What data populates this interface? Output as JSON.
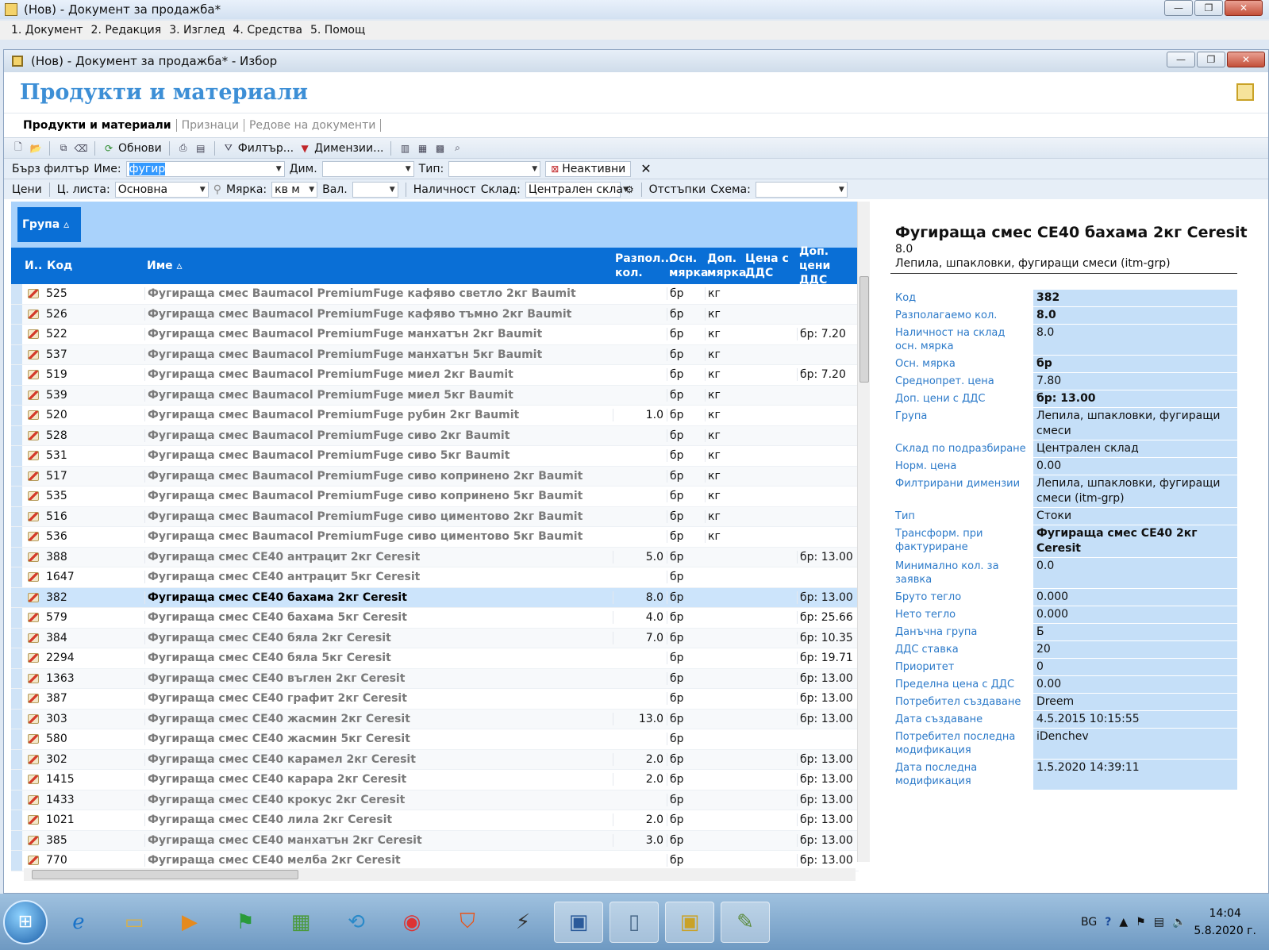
{
  "outer": {
    "title": "(Нов) - Документ за продажба*",
    "menu": [
      "1. Документ",
      "2. Редакция",
      "3. Изглед",
      "4. Средства",
      "5. Помощ"
    ]
  },
  "inner": {
    "title": "(Нов) - Документ за продажба* - Избор",
    "page_title": "Продукти и материали",
    "tabs": [
      "Продукти и материали",
      "Признаци",
      "Редове на документи"
    ]
  },
  "toolbar": {
    "refresh": "Обнови",
    "filter": "Филтър...",
    "dimensions": "Димензии..."
  },
  "filter1": {
    "quick": "Бърз филтър",
    "name_label": "Име:",
    "name_value": "фугир",
    "dim_label": "Дим.",
    "type_label": "Тип:",
    "inactive": "Неактивни"
  },
  "filter2": {
    "prices": "Цени",
    "pricelist_label": "Ц. листа:",
    "pricelist_value": "Основна",
    "unit_label": "Мярка:",
    "unit_value": "кв м",
    "cur_label": "Вал.",
    "stock": "Наличност",
    "warehouse_label": "Склад:",
    "warehouse_value": "Централен скла",
    "discounts": "Отстъпки",
    "scheme_label": "Схема:"
  },
  "grid": {
    "group_chip": "Група ▵",
    "headers": {
      "icon": "И..",
      "code": "Код",
      "name": "Име ▵",
      "qty": "Разпол... кол.",
      "unit": "Осн. мярка",
      "unit2": "Доп. мярка",
      "price": "Цена с ДДС",
      "extra": "Доп. цени ДДС"
    },
    "rows": [
      {
        "code": "525",
        "name": "Фугираща смес Baumacol PremiumFuge кафяво светло 2кг Baumit",
        "qty": "",
        "unit": "бр",
        "unit2": "кг",
        "price": "",
        "extra": ""
      },
      {
        "code": "526",
        "name": "Фугираща смес Baumacol PremiumFuge кафяво тъмно 2кг Baumit",
        "qty": "",
        "unit": "бр",
        "unit2": "кг",
        "price": "",
        "extra": ""
      },
      {
        "code": "522",
        "name": "Фугираща смес Baumacol PremiumFuge манхатън 2кг Baumit",
        "qty": "",
        "unit": "бр",
        "unit2": "кг",
        "price": "",
        "extra": "бр: 7.20"
      },
      {
        "code": "537",
        "name": "Фугираща смес Baumacol PremiumFuge манхатън 5кг Baumit",
        "qty": "",
        "unit": "бр",
        "unit2": "кг",
        "price": "",
        "extra": ""
      },
      {
        "code": "519",
        "name": "Фугираща смес Baumacol PremiumFuge миел 2кг Baumit",
        "qty": "",
        "unit": "бр",
        "unit2": "кг",
        "price": "",
        "extra": "бр: 7.20"
      },
      {
        "code": "539",
        "name": "Фугираща смес Baumacol PremiumFuge миел 5кг Baumit",
        "qty": "",
        "unit": "бр",
        "unit2": "кг",
        "price": "",
        "extra": ""
      },
      {
        "code": "520",
        "name": "Фугираща смес Baumacol PremiumFuge рубин 2кг Baumit",
        "qty": "1.0",
        "unit": "бр",
        "unit2": "кг",
        "price": "",
        "extra": ""
      },
      {
        "code": "528",
        "name": "Фугираща смес Baumacol PremiumFuge сиво 2кг Baumit",
        "qty": "",
        "unit": "бр",
        "unit2": "кг",
        "price": "",
        "extra": ""
      },
      {
        "code": "531",
        "name": "Фугираща смес Baumacol PremiumFuge сиво 5кг Baumit",
        "qty": "",
        "unit": "бр",
        "unit2": "кг",
        "price": "",
        "extra": ""
      },
      {
        "code": "517",
        "name": "Фугираща смес Baumacol PremiumFuge сиво копринено 2кг Baumit",
        "qty": "",
        "unit": "бр",
        "unit2": "кг",
        "price": "",
        "extra": ""
      },
      {
        "code": "535",
        "name": "Фугираща смес Baumacol PremiumFuge сиво копринено 5кг Baumit",
        "qty": "",
        "unit": "бр",
        "unit2": "кг",
        "price": "",
        "extra": ""
      },
      {
        "code": "516",
        "name": "Фугираща смес Baumacol PremiumFuge сиво циментово 2кг Baumit",
        "qty": "",
        "unit": "бр",
        "unit2": "кг",
        "price": "",
        "extra": ""
      },
      {
        "code": "536",
        "name": "Фугираща смес Baumacol PremiumFuge сиво циментово 5кг Baumit",
        "qty": "",
        "unit": "бр",
        "unit2": "кг",
        "price": "",
        "extra": ""
      },
      {
        "code": "388",
        "name": "Фугираща смес CE40 антрацит 2кг Ceresit",
        "qty": "5.0",
        "unit": "бр",
        "unit2": "",
        "price": "",
        "extra": "бр: 13.00"
      },
      {
        "code": "1647",
        "name": "Фугираща смес CE40 антрацит 5кг Ceresit",
        "qty": "",
        "unit": "бр",
        "unit2": "",
        "price": "",
        "extra": ""
      },
      {
        "code": "382",
        "name": "Фугираща смес CE40 бахама 2кг Ceresit",
        "qty": "8.0",
        "unit": "бр",
        "unit2": "",
        "price": "",
        "extra": "бр: 13.00",
        "selected": true
      },
      {
        "code": "579",
        "name": "Фугираща смес CE40 бахама 5кг Ceresit",
        "qty": "4.0",
        "unit": "бр",
        "unit2": "",
        "price": "",
        "extra": "бр: 25.66"
      },
      {
        "code": "384",
        "name": "Фугираща смес CE40 бяла 2кг Ceresit",
        "qty": "7.0",
        "unit": "бр",
        "unit2": "",
        "price": "",
        "extra": "бр: 10.35"
      },
      {
        "code": "2294",
        "name": "Фугираща смес CE40 бяла 5кг Ceresit",
        "qty": "",
        "unit": "бр",
        "unit2": "",
        "price": "",
        "extra": "бр: 19.71"
      },
      {
        "code": "1363",
        "name": "Фугираща смес CE40 въглен 2кг Ceresit",
        "qty": "",
        "unit": "бр",
        "unit2": "",
        "price": "",
        "extra": "бр: 13.00"
      },
      {
        "code": "387",
        "name": "Фугираща смес CE40 графит 2кг Ceresit",
        "qty": "",
        "unit": "бр",
        "unit2": "",
        "price": "",
        "extra": "бр: 13.00"
      },
      {
        "code": "303",
        "name": "Фугираща смес CE40 жасмин 2кг Ceresit",
        "qty": "13.0",
        "unit": "бр",
        "unit2": "",
        "price": "",
        "extra": "бр: 13.00"
      },
      {
        "code": "580",
        "name": "Фугираща смес CE40 жасмин 5кг Ceresit",
        "qty": "",
        "unit": "бр",
        "unit2": "",
        "price": "",
        "extra": ""
      },
      {
        "code": "302",
        "name": "Фугираща смес CE40 карамел 2кг Ceresit",
        "qty": "2.0",
        "unit": "бр",
        "unit2": "",
        "price": "",
        "extra": "бр: 13.00"
      },
      {
        "code": "1415",
        "name": "Фугираща смес CE40 карара 2кг Ceresit",
        "qty": "2.0",
        "unit": "бр",
        "unit2": "",
        "price": "",
        "extra": "бр: 13.00"
      },
      {
        "code": "1433",
        "name": "Фугираща смес CE40 крокус 2кг Ceresit",
        "qty": "",
        "unit": "бр",
        "unit2": "",
        "price": "",
        "extra": "бр: 13.00"
      },
      {
        "code": "1021",
        "name": "Фугираща смес CE40 лила 2кг Ceresit",
        "qty": "2.0",
        "unit": "бр",
        "unit2": "",
        "price": "",
        "extra": "бр: 13.00"
      },
      {
        "code": "385",
        "name": "Фугираща смес CE40 манхатън 2кг Ceresit",
        "qty": "3.0",
        "unit": "бр",
        "unit2": "",
        "price": "",
        "extra": "бр: 13.00"
      },
      {
        "code": "770",
        "name": "Фугираща смес CE40 мелба 2кг Ceresit",
        "qty": "",
        "unit": "бр",
        "unit2": "",
        "price": "",
        "extra": "бр: 13.00"
      }
    ]
  },
  "detail": {
    "title": "Фугираща смес CE40 бахама 2кг Ceresit",
    "sub1": "8.0",
    "sub2": "Лепила, шпакловки, фугиращи смеси (itm-grp)",
    "fields": [
      {
        "key": "Код",
        "value": "382",
        "bold": true
      },
      {
        "key": "Разполагаемо кол.",
        "value": "8.0",
        "bold": true
      },
      {
        "key": "Наличност на склад осн. мярка",
        "value": "8.0"
      },
      {
        "key": "Осн. мярка",
        "value": "бр",
        "bold": true
      },
      {
        "key": "Среднопрет. цена",
        "value": "7.80"
      },
      {
        "key": "Доп. цени с ДДС",
        "value": "бр: 13.00",
        "bold": true
      },
      {
        "key": "Група",
        "value": "Лепила, шпакловки, фугиращи смеси"
      },
      {
        "key": "Склад по подразбиране",
        "value": "Централен склад"
      },
      {
        "key": "Норм. цена",
        "value": "0.00"
      },
      {
        "key": "Филтрирани димензии",
        "value": "Лепила, шпакловки, фугиращи смеси (itm-grp)"
      },
      {
        "key": "Тип",
        "value": "Стоки"
      },
      {
        "key": "Трансформ. при фактуриране",
        "value": "Фугираща смес CE40 2кг Ceresit",
        "bold": true
      },
      {
        "key": "Минимално кол. за заявка",
        "value": "0.0"
      },
      {
        "key": "Бруто тегло",
        "value": "0.000"
      },
      {
        "key": "Нето тегло",
        "value": "0.000"
      },
      {
        "key": "Данъчна група",
        "value": "Б"
      },
      {
        "key": "ДДС ставка",
        "value": "20"
      },
      {
        "key": "Приоритет",
        "value": "0"
      },
      {
        "key": "Пределна цена с ДДС",
        "value": "0.00"
      },
      {
        "key": "Потребител създаване",
        "value": "Dreem"
      },
      {
        "key": "Дата създаване",
        "value": "4.5.2015 10:15:55"
      },
      {
        "key": "Потребител последна модификация",
        "value": "iDenchev"
      },
      {
        "key": "Дата последна модификация",
        "value": "1.5.2020 14:39:11"
      }
    ]
  },
  "taskbar": {
    "lang": "BG",
    "time": "14:04",
    "date": "5.8.2020 г."
  }
}
